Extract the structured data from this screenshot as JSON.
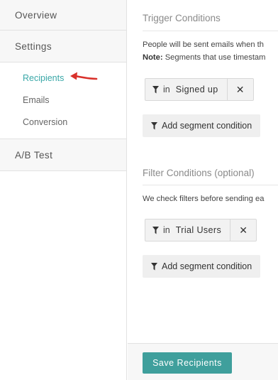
{
  "sidebar": {
    "overview": "Overview",
    "settings": "Settings",
    "sub_items": [
      "Recipients",
      "Emails",
      "Conversion"
    ],
    "ab_test": "A/B Test"
  },
  "trigger": {
    "title": "Trigger Conditions",
    "line1": "People will be sent emails when th",
    "note_label": "Note:",
    "note_text": " Segments that use timestam",
    "condition": {
      "operator": "in",
      "value": "Signed up"
    },
    "add_label": "Add segment condition"
  },
  "filter": {
    "title": "Filter Conditions (optional)",
    "line1": "We check filters before sending ea",
    "condition": {
      "operator": "in",
      "value": "Trial Users"
    },
    "add_label": "Add segment condition"
  },
  "footer": {
    "save_label": "Save Recipients"
  },
  "colors": {
    "accent": "#3aa8a8",
    "save_button": "#3f9f9c",
    "annotation_arrow": "#d9312b"
  },
  "icons": {
    "filter": "funnel-icon",
    "remove": "close-icon",
    "annotation": "red-arrow"
  }
}
